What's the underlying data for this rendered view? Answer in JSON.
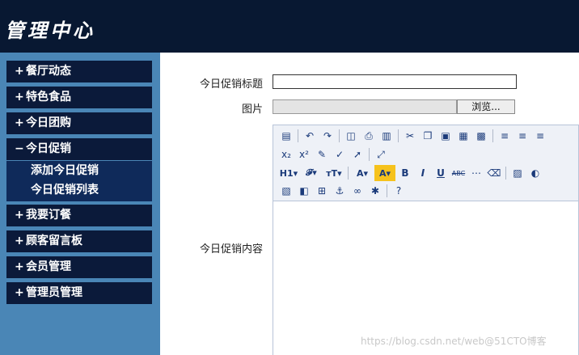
{
  "header": {
    "title": "管理中心"
  },
  "sidebar": {
    "items": [
      {
        "sign": "+",
        "label": "餐厅动态"
      },
      {
        "sign": "+",
        "label": "特色食品"
      },
      {
        "sign": "+",
        "label": "今日团购"
      },
      {
        "sign": "−",
        "label": "今日促销"
      },
      {
        "sign": "+",
        "label": "我要订餐"
      },
      {
        "sign": "+",
        "label": "顾客留言板"
      },
      {
        "sign": "+",
        "label": "会员管理"
      },
      {
        "sign": "+",
        "label": "管理员管理"
      }
    ],
    "submenu": [
      "添加今日促销",
      "今日促销列表"
    ]
  },
  "form": {
    "title_label": "今日促销标题",
    "title_value": "",
    "image_label": "图片",
    "browse_label": "浏览...",
    "content_label": "今日促销内容"
  },
  "toolbar": {
    "row1": [
      "source-icon",
      "undo-icon",
      "redo-icon",
      "preview-icon",
      "print-icon",
      "template-icon",
      "cut-icon",
      "copy-icon",
      "paste-icon",
      "paste-text-icon",
      "paste-word-icon",
      "align-left-icon",
      "align-center-icon",
      "align-right-icon"
    ],
    "row2": [
      "subscript-icon",
      "superscript-icon",
      "clear-format-icon",
      "spellcheck-icon",
      "select-icon",
      "fullscreen-icon"
    ],
    "row3": [
      "heading-icon",
      "font-family-icon",
      "font-size-icon",
      "font-color-icon",
      "highlight-icon",
      "bold-icon",
      "italic-icon",
      "underline-icon",
      "strikethrough-icon",
      "hr-icon",
      "eraser-icon",
      "image-icon",
      "flash-icon"
    ],
    "row4": [
      "insert-image-icon",
      "media-icon",
      "table-icon",
      "anchor-icon",
      "link-icon",
      "unlink-icon",
      "help-icon"
    ]
  },
  "watermark": "https://blog.csdn.net/web@51CTO博客"
}
